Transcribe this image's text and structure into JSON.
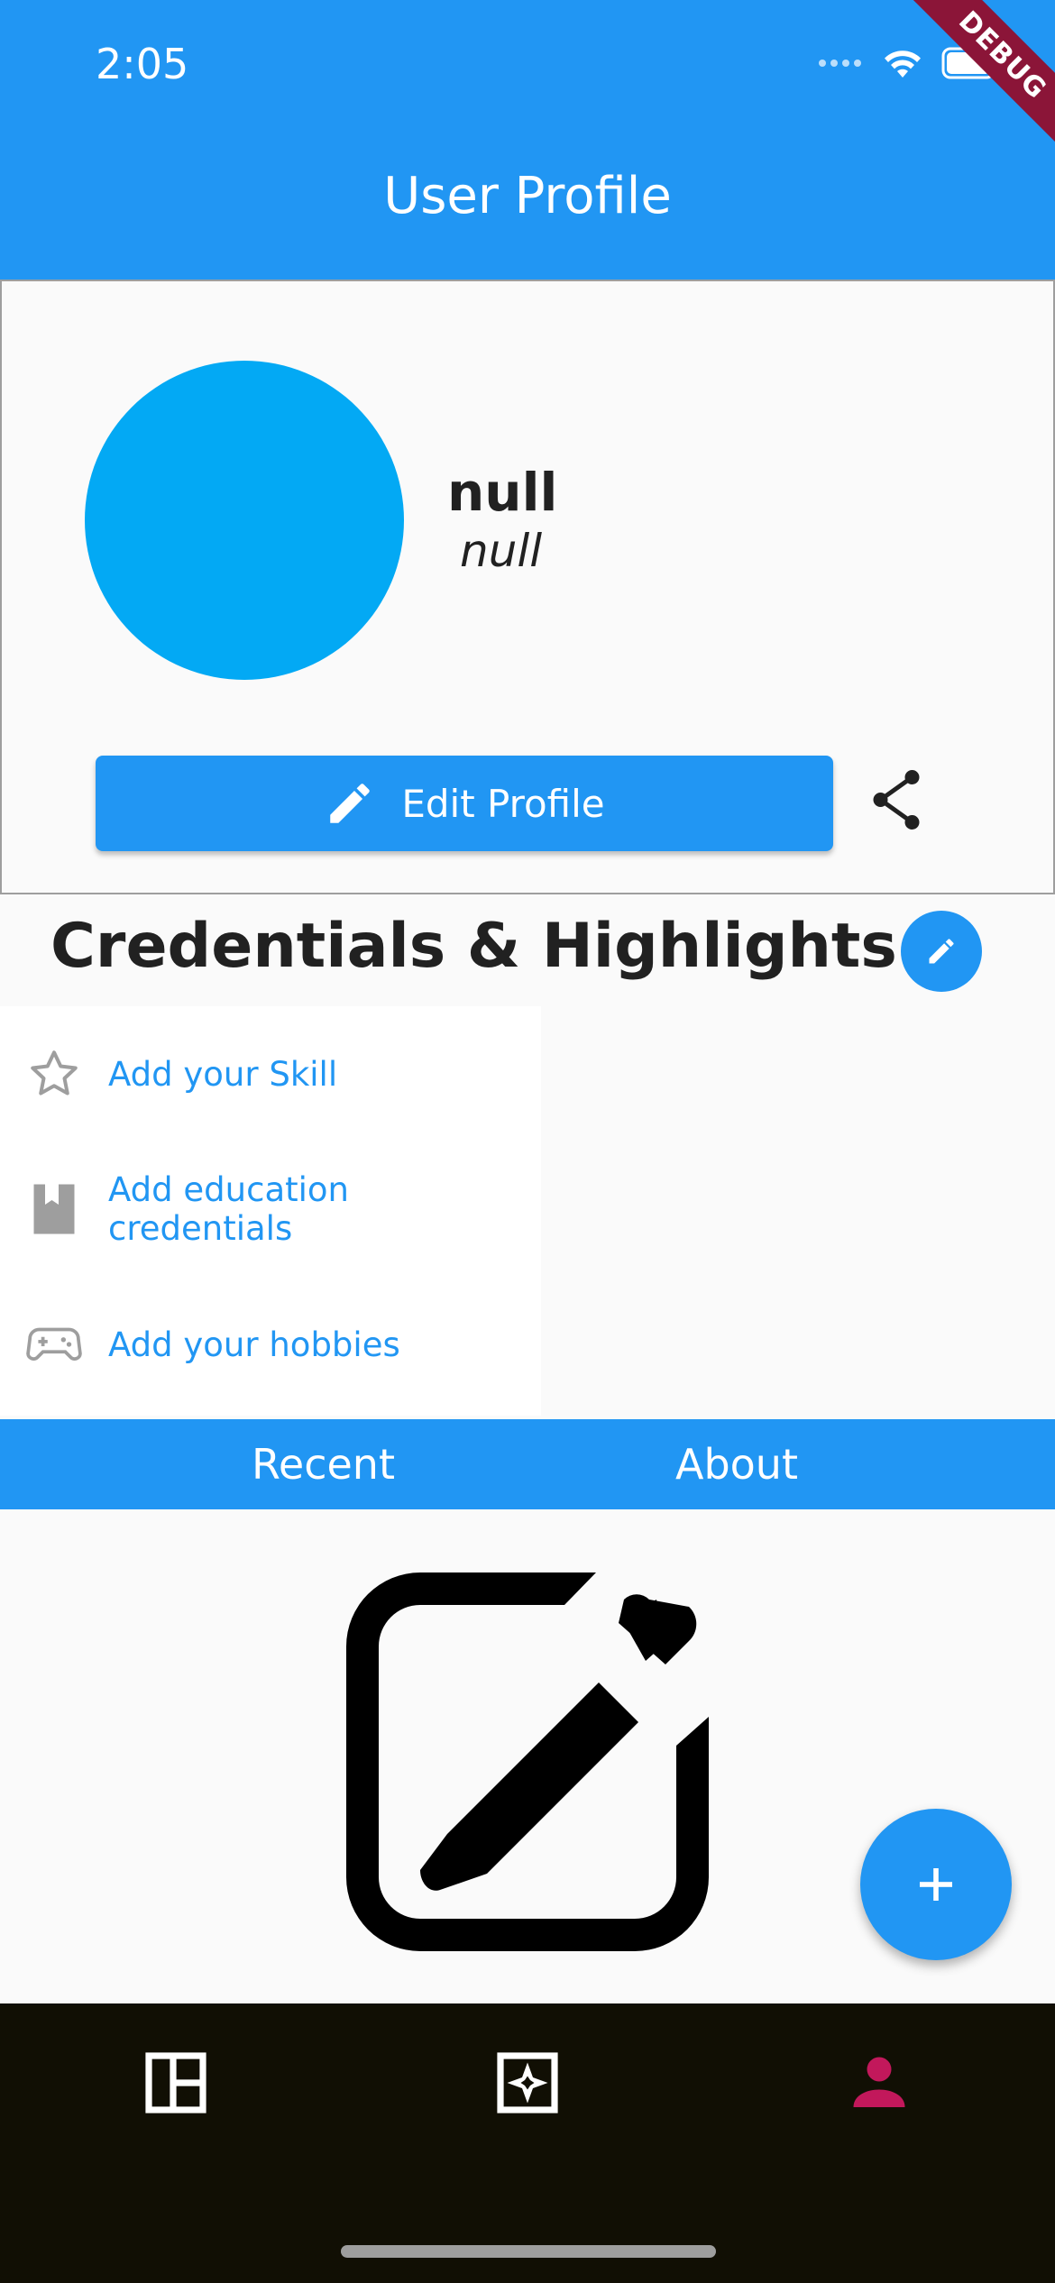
{
  "status_bar": {
    "time": "2:05",
    "debug_label": "DEBUG"
  },
  "app_bar": {
    "title": "User Profile"
  },
  "profile": {
    "name": "null",
    "subtitle": "null",
    "edit_button_label": "Edit Profile",
    "avatar_color": "#03a9f4"
  },
  "credentials": {
    "title": "Credentials & Highlights",
    "items": [
      {
        "icon": "star-outline-icon",
        "label": "Add your Skill"
      },
      {
        "icon": "book-icon",
        "label": "Add education credentials"
      },
      {
        "icon": "gamepad-icon",
        "label": "Add your hobbies"
      }
    ]
  },
  "tabs": [
    {
      "label": "Recent"
    },
    {
      "label": "About"
    }
  ],
  "bottom_nav": {
    "items": [
      {
        "icon": "dashboard-icon",
        "active": false
      },
      {
        "icon": "sparkle-box-icon",
        "active": false
      },
      {
        "icon": "person-icon",
        "active": true
      }
    ]
  },
  "colors": {
    "primary": "#2196f3",
    "nav_background": "#110f04",
    "active_nav": "#c2185b",
    "debug_banner": "#8b1538"
  }
}
